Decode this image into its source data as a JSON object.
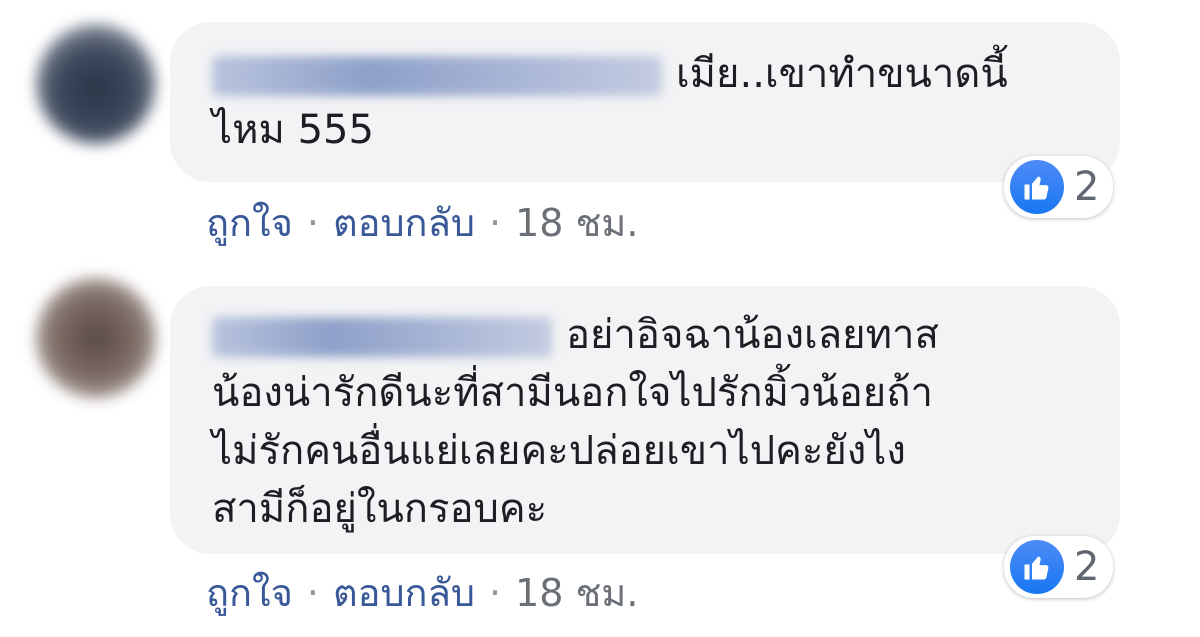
{
  "comments": [
    {
      "text_line_1": "เมีย..เขาทำขนาดนี้",
      "text_line_2": "ไหม 555",
      "like_label": "ถูกใจ",
      "reply_label": "ตอบกลับ",
      "time": "18 ชม.",
      "reaction_count": "2"
    },
    {
      "text_line_1": "อย่าอิจฉาน้องเลยทาส",
      "text_line_2": "น้องน่ารักดีนะที่สามีนอกใจไปรักมิ้วน้อยถ้า",
      "text_line_3": "ไม่รักคนอื่นแย่เลยคะปล่อยเขาไปคะยังไง",
      "text_line_4": "สามีก็อยู่ในกรอบคะ",
      "like_label": "ถูกใจ",
      "reply_label": "ตอบกลับ",
      "time": "18 ชม.",
      "reaction_count": "2"
    }
  ],
  "separator": "·",
  "colors": {
    "bubble": "#f2f3f5",
    "link": "#385898",
    "like_blue": "#1877f2"
  },
  "icons": {
    "reaction": "thumbs-up-icon"
  }
}
